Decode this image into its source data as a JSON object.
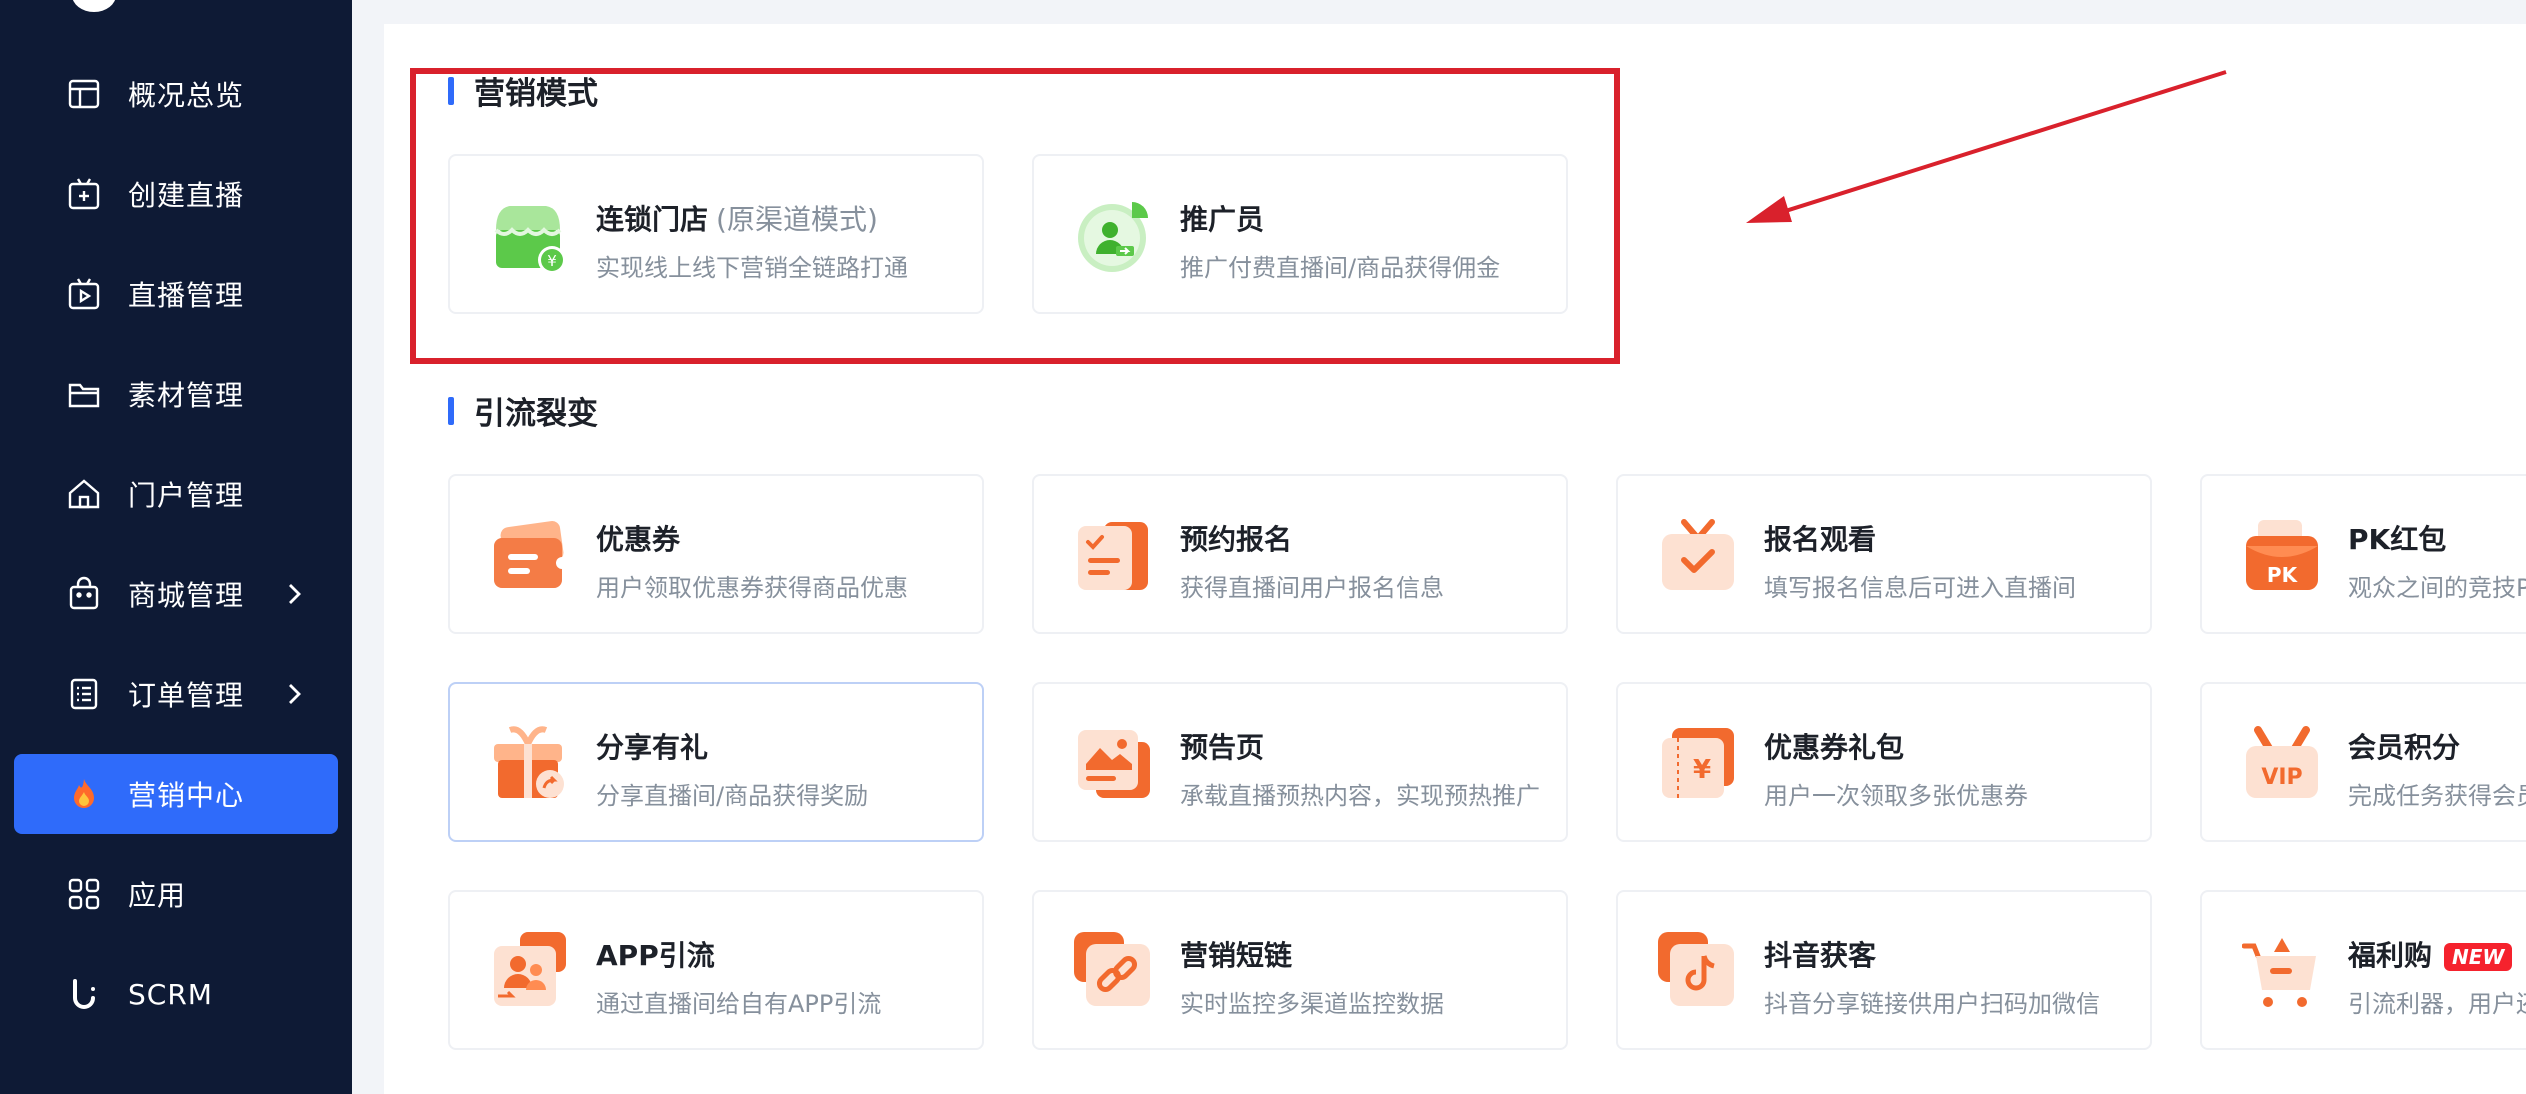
{
  "sidebar": {
    "items": [
      {
        "label": "概况总览",
        "icon": "dashboard-icon"
      },
      {
        "label": "创建直播",
        "icon": "create-live-icon"
      },
      {
        "label": "直播管理",
        "icon": "live-manage-icon"
      },
      {
        "label": "素材管理",
        "icon": "folder-icon"
      },
      {
        "label": "门户管理",
        "icon": "home-icon"
      },
      {
        "label": "商城管理",
        "icon": "shopping-bag-icon"
      },
      {
        "label": "订单管理",
        "icon": "order-icon"
      },
      {
        "label": "营销中心",
        "icon": "fire-icon"
      },
      {
        "label": "应用",
        "icon": "apps-grid-icon"
      },
      {
        "label": "SCRM",
        "icon": "scrm-icon"
      }
    ]
  },
  "sections": {
    "marketing_mode": {
      "title": "营销模式",
      "cards": [
        {
          "title": "连锁门店",
          "subtitle": "(原渠道模式)",
          "desc": "实现线上线下营销全链路打通",
          "icon": "chain-store-icon"
        },
        {
          "title": "推广员",
          "desc": "推广付费直播间/商品获得佣金",
          "icon": "promoter-icon"
        }
      ]
    },
    "traffic": {
      "title": "引流裂变",
      "cards": [
        {
          "title": "优惠券",
          "desc": "用户领取优惠券获得商品优惠",
          "icon": "coupon-icon"
        },
        {
          "title": "预约报名",
          "desc": "获得直播间用户报名信息",
          "icon": "reservation-icon"
        },
        {
          "title": "报名观看",
          "desc": "填写报名信息后可进入直播间",
          "icon": "signup-watch-icon"
        },
        {
          "title": "PK红包",
          "desc": "观众之间的竞技PK",
          "icon": "pk-red-packet-icon"
        },
        {
          "title": "分享有礼",
          "desc": "分享直播间/商品获得奖励",
          "icon": "share-gift-icon"
        },
        {
          "title": "预告页",
          "desc": "承载直播预热内容，实现预热推广",
          "icon": "preview-page-icon"
        },
        {
          "title": "优惠券礼包",
          "desc": "用户一次领取多张优惠券",
          "icon": "coupon-pack-icon"
        },
        {
          "title": "会员积分",
          "desc": "完成任务获得会员积分",
          "icon": "vip-points-icon"
        },
        {
          "title": "APP引流",
          "desc": "通过直播间给自有APP引流",
          "icon": "app-traffic-icon"
        },
        {
          "title": "营销短链",
          "desc": "实时监控多渠道监控数据",
          "icon": "short-link-icon"
        },
        {
          "title": "抖音获客",
          "desc": "抖音分享链接供用户扫码加微信",
          "icon": "douyin-icon"
        },
        {
          "title": "福利购",
          "badge": "NEW",
          "desc": "引流利器，用户还",
          "icon": "welfare-cart-icon"
        }
      ]
    }
  },
  "colors": {
    "sidebar_bg": "#0e1a35",
    "active": "#2f6bfa",
    "annotation": "#d9212c",
    "icon_orange": "#f26a2e",
    "icon_green": "#5cc94a"
  }
}
